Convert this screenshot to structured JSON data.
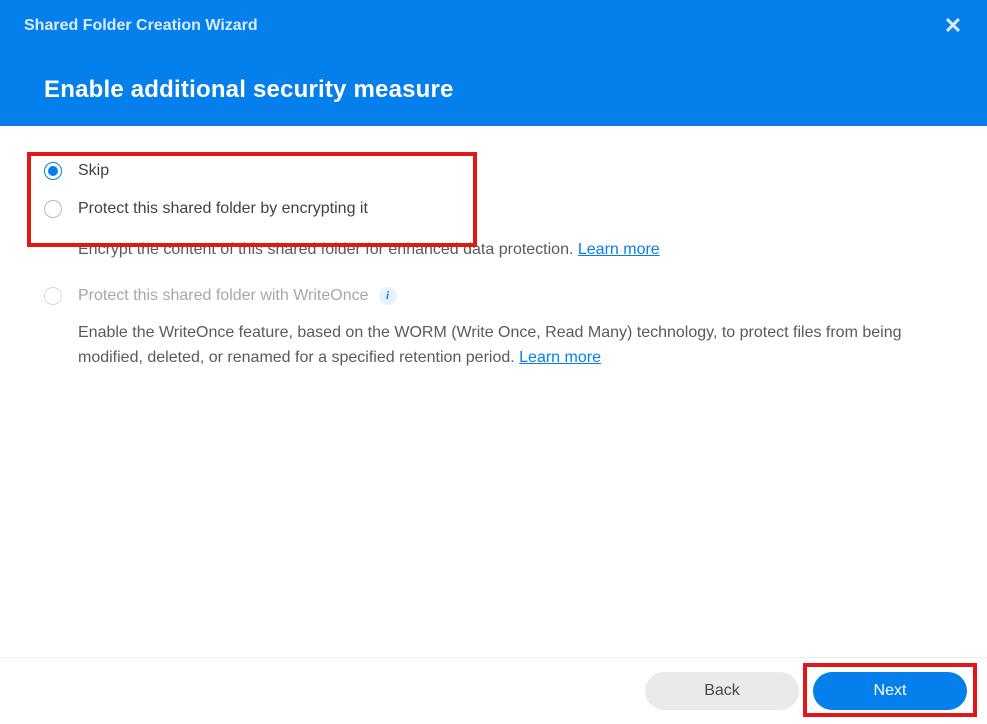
{
  "window": {
    "title": "Shared Folder Creation Wizard",
    "heading": "Enable additional security measure"
  },
  "options": {
    "skip": {
      "label": "Skip",
      "selected": true
    },
    "encrypt": {
      "label": "Protect this shared folder by encrypting it",
      "desc_prefix": "Encrypt the content of this shared folder for enhanced data protection. ",
      "learn_more": "Learn more",
      "selected": false
    },
    "writeonce": {
      "label": "Protect this shared folder with WriteOnce",
      "desc_prefix": "Enable the WriteOnce feature, based on the WORM (Write Once, Read Many) technology, to protect files from being modified, deleted, or renamed for a specified retention period. ",
      "learn_more": "Learn more",
      "enabled": false
    }
  },
  "footer": {
    "back": "Back",
    "next": "Next"
  }
}
